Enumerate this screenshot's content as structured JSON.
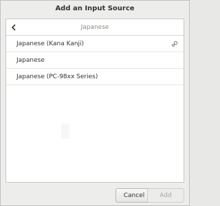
{
  "dialog": {
    "title": "Add an Input Source"
  },
  "search": {
    "text": "Japanese"
  },
  "items": [
    {
      "label": "Japanese (Kana Kanji)",
      "has_settings": true
    },
    {
      "label": "Japanese",
      "has_settings": false
    },
    {
      "label": "Japanese (PC-98xx Series)",
      "has_settings": false
    }
  ],
  "footer": {
    "cancel_label": "Cancel",
    "add_label": "Add"
  },
  "icons": {
    "back": "chevron-left-icon",
    "settings": "gear-icon"
  }
}
